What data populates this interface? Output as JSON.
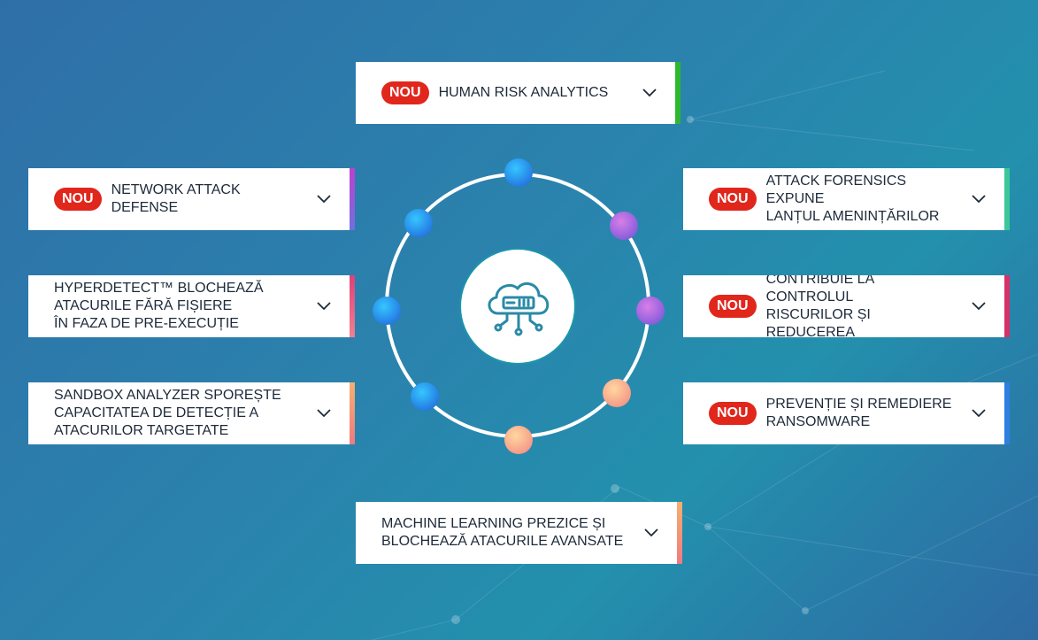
{
  "badge_text": "NOU",
  "icons": {
    "chevron": "chevron-down-icon",
    "center": "cloud-server-icon"
  },
  "colors": {
    "badge": "#e1261c",
    "ring": "#ffffff"
  },
  "cards": {
    "human_risk": {
      "label": "HUMAN RISK ANALYTICS",
      "badge": "NOU"
    },
    "network_attack": {
      "label": "NETWORK ATTACK DEFENSE",
      "badge": "NOU"
    },
    "attack_forensics": {
      "label": "ATTACK FORENSICS EXPUNE\nLANȚUL AMENINȚĂRILOR",
      "badge": "NOU"
    },
    "hyperdetect": {
      "label": "HYPERDETECT™ BLOCHEAZĂ\nATACURILE FĂRĂ FIȘIERE\nÎN FAZA DE PRE-EXECUȚIE"
    },
    "risk_analysis": {
      "label": "ANALIZA RISCURILOR\nCONTRIBUIE LA CONTROLUL\nRISCURILOR ȘI REDUCEREA\nSUPRAFEȚEI DE ATAC",
      "badge": "NOU"
    },
    "sandbox": {
      "label": "SANDBOX ANALYZER SPOREȘTE\nCAPACITATEA DE DETECȚIE A\nATACURILOR TARGETATE"
    },
    "ransomware": {
      "label": "PREVENȚIE ȘI REMEDIERE\nRANSOMWARE",
      "badge": "NOU"
    },
    "machine_learning": {
      "label": "MACHINE LEARNING PREZICE ȘI\nBLOCHEAZĂ ATACURILE AVANSATE"
    }
  }
}
